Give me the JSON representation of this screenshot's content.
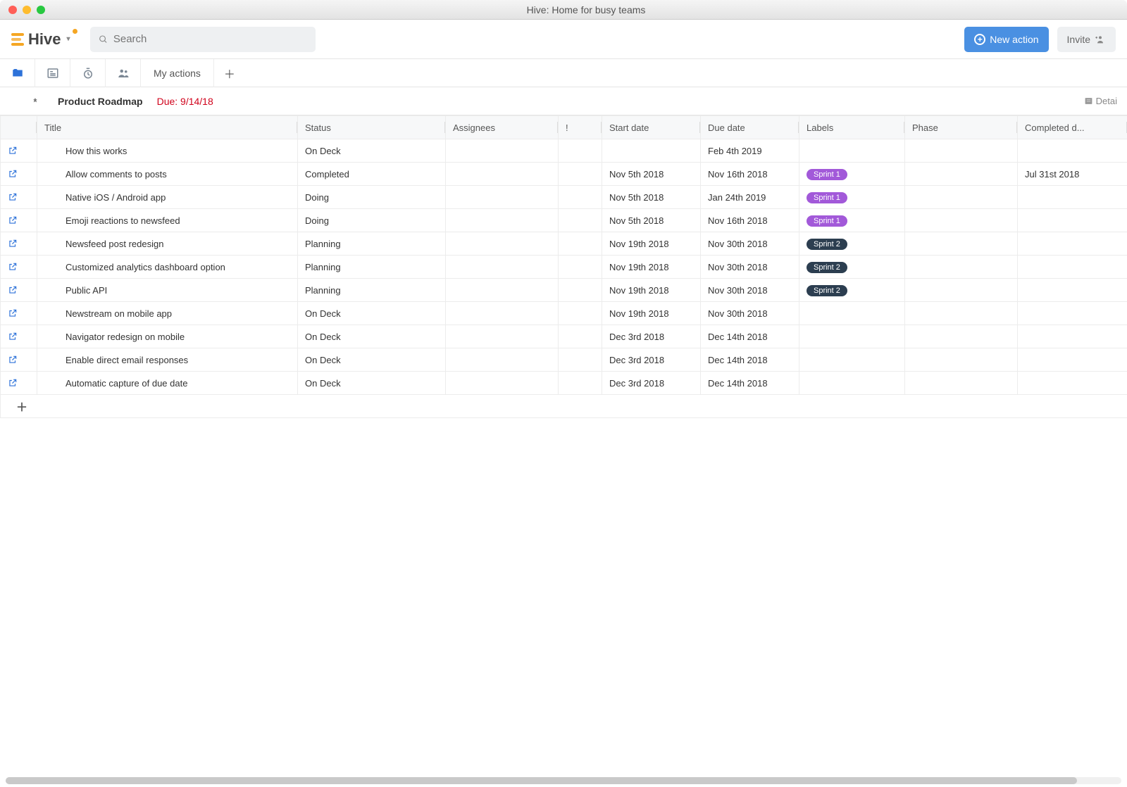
{
  "window": {
    "title": "Hive: Home for busy teams"
  },
  "header": {
    "brand": "Hive",
    "search_placeholder": "Search",
    "new_action_label": "New action",
    "invite_label": "Invite"
  },
  "viewbar": {
    "current_view_label": "My actions"
  },
  "pinned": {
    "project_name": "Product Roadmap",
    "due_label": "Due: 9/14/18",
    "detail_label": "Detai"
  },
  "columns": {
    "title": "Title",
    "status": "Status",
    "assignees": "Assignees",
    "priority": "!",
    "start": "Start date",
    "due": "Due date",
    "labels": "Labels",
    "phase": "Phase",
    "completed": "Completed d..."
  },
  "labels": {
    "sprint1": "Sprint 1",
    "sprint2": "Sprint 2"
  },
  "rows": [
    {
      "title": "How this works",
      "status": "On Deck",
      "start": "",
      "due": "Feb 4th 2019",
      "label": "",
      "completed": ""
    },
    {
      "title": "Allow comments to posts",
      "status": "Completed",
      "start": "Nov 5th 2018",
      "due": "Nov 16th 2018",
      "label": "sprint1",
      "completed": "Jul 31st 2018"
    },
    {
      "title": "Native iOS / Android app",
      "status": "Doing",
      "start": "Nov 5th 2018",
      "due": "Jan 24th 2019",
      "label": "sprint1",
      "completed": ""
    },
    {
      "title": "Emoji reactions to newsfeed",
      "status": "Doing",
      "start": "Nov 5th 2018",
      "due": "Nov 16th 2018",
      "label": "sprint1",
      "completed": ""
    },
    {
      "title": "Newsfeed post redesign",
      "status": "Planning",
      "start": "Nov 19th 2018",
      "due": "Nov 30th 2018",
      "label": "sprint2",
      "completed": ""
    },
    {
      "title": "Customized analytics dashboard option",
      "status": "Planning",
      "start": "Nov 19th 2018",
      "due": "Nov 30th 2018",
      "label": "sprint2",
      "completed": ""
    },
    {
      "title": "Public API",
      "status": "Planning",
      "start": "Nov 19th 2018",
      "due": "Nov 30th 2018",
      "label": "sprint2",
      "completed": ""
    },
    {
      "title": "Newstream on mobile app",
      "status": "On Deck",
      "start": "Nov 19th 2018",
      "due": "Nov 30th 2018",
      "label": "",
      "completed": ""
    },
    {
      "title": "Navigator redesign on mobile",
      "status": "On Deck",
      "start": "Dec 3rd 2018",
      "due": "Dec 14th 2018",
      "label": "",
      "completed": ""
    },
    {
      "title": "Enable direct email responses",
      "status": "On Deck",
      "start": "Dec 3rd 2018",
      "due": "Dec 14th 2018",
      "label": "",
      "completed": ""
    },
    {
      "title": "Automatic capture of due date",
      "status": "On Deck",
      "start": "Dec 3rd 2018",
      "due": "Dec 14th 2018",
      "label": "",
      "completed": ""
    }
  ]
}
